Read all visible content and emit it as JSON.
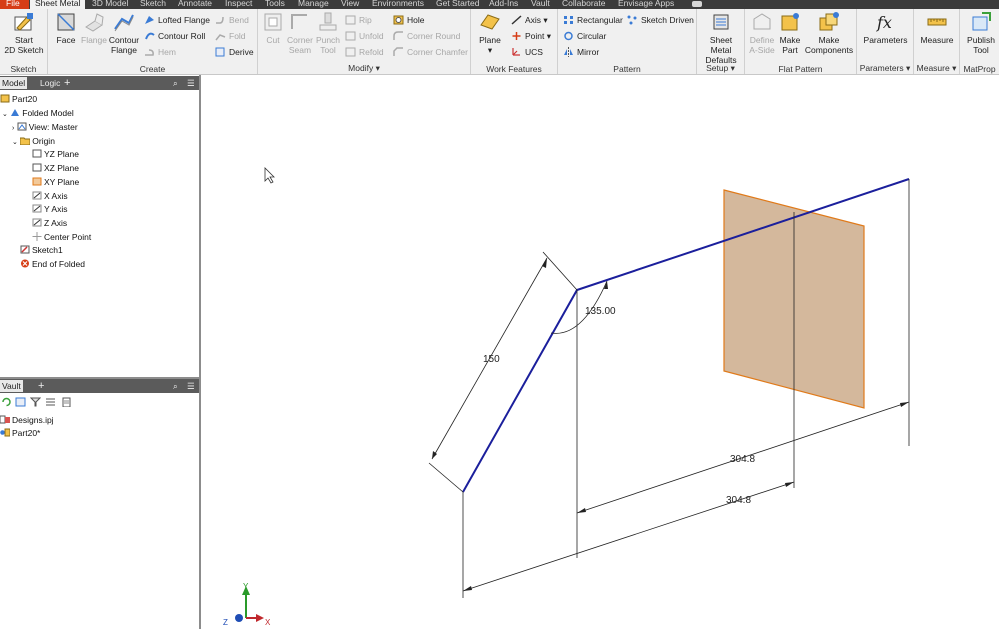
{
  "menu": {
    "tabs": [
      "File",
      "Sheet Metal",
      "3D Model",
      "Sketch",
      "Annotate",
      "Inspect",
      "Tools",
      "Manage",
      "View",
      "Environments",
      "Get Started",
      "Add-Ins",
      "Vault",
      "Collaborate",
      "Envisage Apps"
    ],
    "active_tab": "Sheet Metal"
  },
  "ribbon": {
    "sketch": {
      "label": "Sketch",
      "start_line1": "Start",
      "start_line2": "2D Sketch"
    },
    "create": {
      "label": "Create",
      "face": "Face",
      "flange": "Flange",
      "contour_line1": "Contour",
      "contour_line2": "Flange",
      "lofted_flange": "Lofted Flange",
      "contour_roll": "Contour Roll",
      "hem": "Hem",
      "bend": "Bend",
      "fold": "Fold",
      "derive": "Derive"
    },
    "modify": {
      "label": "Modify",
      "cut": "Cut",
      "corner_seam_1": "Corner",
      "corner_seam_2": "Seam",
      "punch_1": "Punch",
      "punch_2": "Tool",
      "rip": "Rip",
      "unfold": "Unfold",
      "refold": "Refold",
      "hole": "Hole",
      "corner_round": "Corner Round",
      "corner_chamfer": "Corner Chamfer"
    },
    "work_features": {
      "label": "Work Features",
      "plane": "Plane",
      "axis": "Axis",
      "point": "Point",
      "ucs": "UCS"
    },
    "pattern": {
      "label": "Pattern",
      "rectangular": "Rectangular",
      "circular": "Circular",
      "mirror": "Mirror",
      "sketch_driven": "Sketch Driven"
    },
    "setup": {
      "label": "Setup",
      "defaults_1": "Sheet Metal",
      "defaults_2": "Defaults"
    },
    "flat_pattern": {
      "label": "Flat Pattern",
      "define_1": "Define",
      "define_2": "A-Side",
      "make_part_1": "Make",
      "make_part_2": "Part",
      "make_comp_1": "Make",
      "make_comp_2": "Components"
    },
    "parameters": {
      "label": "Parameters",
      "button": "Parameters"
    },
    "measure": {
      "label": "Measure",
      "button": "Measure"
    },
    "matprop": {
      "label": "MatProp",
      "publish_1": "Publish",
      "publish_2": "Tool"
    }
  },
  "browser": {
    "tabs": {
      "model": "Model",
      "logic": "Logic",
      "add": "+"
    },
    "tree": {
      "root": "Part20",
      "folded_model": "Folded Model",
      "view": "View: Master",
      "origin": "Origin",
      "yz_plane": "YZ Plane",
      "xz_plane": "XZ Plane",
      "xy_plane": "XY Plane",
      "x_axis": "X Axis",
      "y_axis": "Y Axis",
      "z_axis": "Z Axis",
      "center_point": "Center Point",
      "sketch1": "Sketch1",
      "end_of_folded": "End of Folded"
    }
  },
  "vault": {
    "tabs": {
      "vault": "Vault",
      "add": "+"
    },
    "items": {
      "project": "Designs.ipj",
      "part": "Part20*"
    }
  },
  "dimensions": {
    "length_150": "150",
    "angle": "135.00",
    "width_top": "304.8",
    "width_bottom": "304.8"
  },
  "triad": {
    "x": "X",
    "y": "Y",
    "z": "Z"
  },
  "colors": {
    "sketch_line": "#1b1f9c",
    "plane_fill": "#d4b89c",
    "plane_edge": "#e07a1a",
    "file_tab": "#d63d16"
  }
}
